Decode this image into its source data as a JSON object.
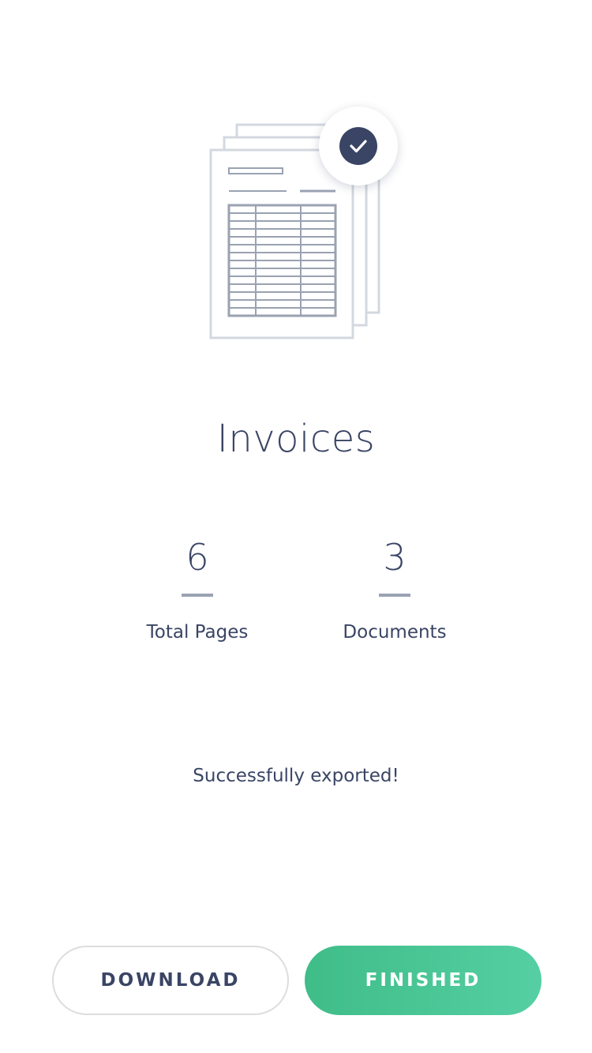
{
  "illustration": {
    "icon": "invoice-stack-icon",
    "badge_icon": "checkmark-icon",
    "badge_color": "#3a4565",
    "paper_stroke": "#d3d8e0",
    "table_stroke": "#9aa2b2"
  },
  "title": "Invoices",
  "stats": [
    {
      "value": "6",
      "label": "Total Pages"
    },
    {
      "value": "3",
      "label": "Documents"
    }
  ],
  "status_message": "Successfully exported!",
  "buttons": {
    "download_label": "DOWNLOAD",
    "finished_label": "FINISHED",
    "finished_gradient": [
      "#3fbd88",
      "#55cfa3"
    ]
  },
  "colors": {
    "text": "#3a4565",
    "rule": "#9aa2b2",
    "outline": "#dddddd"
  }
}
